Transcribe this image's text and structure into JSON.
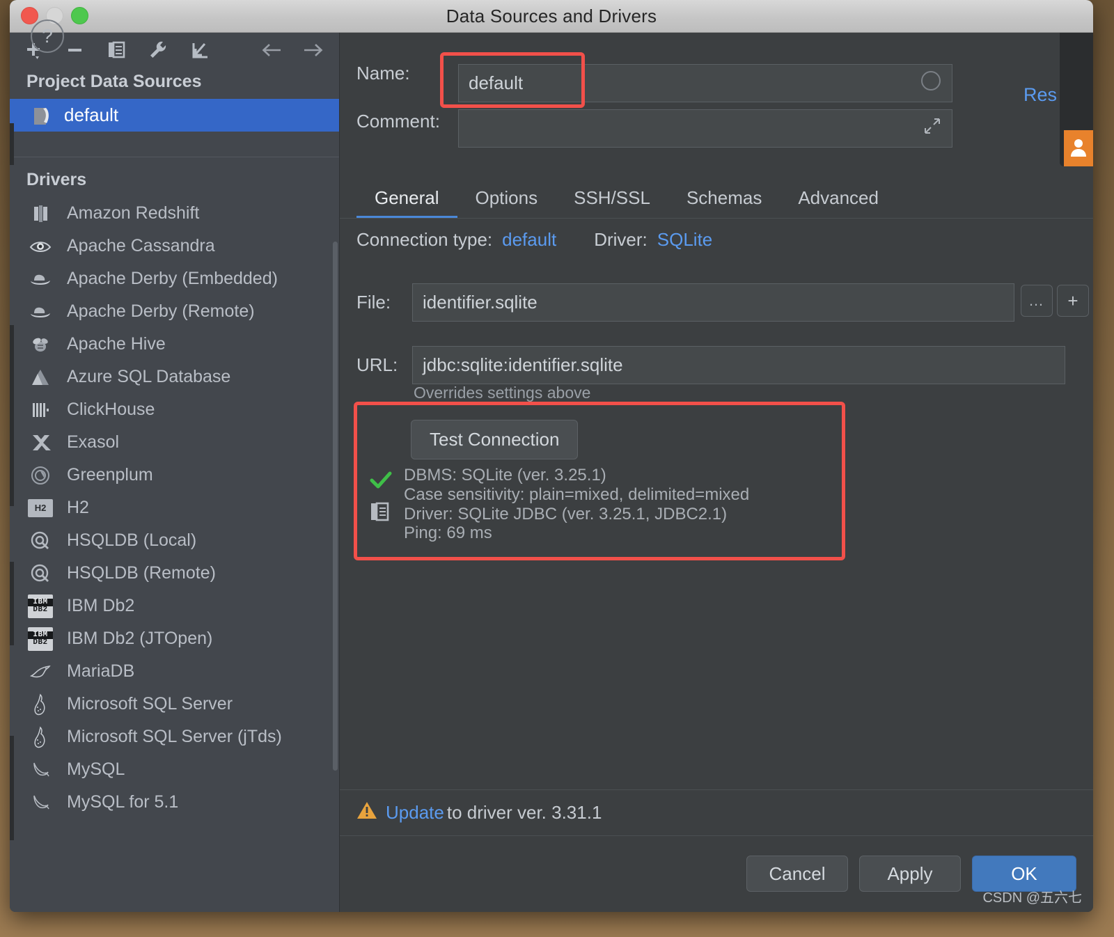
{
  "window": {
    "title": "Data Sources and Drivers",
    "traffic_lights": [
      "close",
      "minimize",
      "zoom"
    ]
  },
  "sidebar": {
    "toolbar": [
      {
        "name": "add-data-source-button",
        "icon": "plus-dropdown-icon"
      },
      {
        "name": "remove-data-source-button",
        "icon": "minus-icon"
      },
      {
        "name": "duplicate-data-source-button",
        "icon": "copy-icon"
      },
      {
        "name": "driver-properties-button",
        "icon": "wrench-icon"
      },
      {
        "name": "import-data-source-button",
        "icon": "import-arrow-icon"
      },
      {
        "name": "navigate-back-button",
        "icon": "arrow-left-icon"
      },
      {
        "name": "navigate-forward-button",
        "icon": "arrow-right-icon"
      }
    ],
    "project_sources_title": "Project Data Sources",
    "data_sources": [
      {
        "label": "default",
        "selected": true,
        "icon": "sqlite-icon"
      }
    ],
    "drivers_title": "Drivers",
    "drivers": [
      {
        "label": "Amazon Redshift",
        "icon": "redshift-icon"
      },
      {
        "label": "Apache Cassandra",
        "icon": "cassandra-eye-icon"
      },
      {
        "label": "Apache Derby (Embedded)",
        "icon": "derby-hat-icon"
      },
      {
        "label": "Apache Derby (Remote)",
        "icon": "derby-hat-icon"
      },
      {
        "label": "Apache Hive",
        "icon": "hive-bee-icon"
      },
      {
        "label": "Azure SQL Database",
        "icon": "azure-icon"
      },
      {
        "label": "ClickHouse",
        "icon": "clickhouse-icon"
      },
      {
        "label": "Exasol",
        "icon": "exasol-x-icon"
      },
      {
        "label": "Greenplum",
        "icon": "greenplum-icon"
      },
      {
        "label": "H2",
        "icon": "h2-icon"
      },
      {
        "label": "HSQLDB (Local)",
        "icon": "hsqldb-icon"
      },
      {
        "label": "HSQLDB (Remote)",
        "icon": "hsqldb-icon"
      },
      {
        "label": "IBM Db2",
        "icon": "ibm-db2-icon"
      },
      {
        "label": "IBM Db2 (JTOpen)",
        "icon": "ibm-db2-icon"
      },
      {
        "label": "MariaDB",
        "icon": "mariadb-seal-icon"
      },
      {
        "label": "Microsoft SQL Server",
        "icon": "mssql-icon"
      },
      {
        "label": "Microsoft SQL Server (jTds)",
        "icon": "mssql-icon"
      },
      {
        "label": "MySQL",
        "icon": "mysql-dolphin-icon"
      },
      {
        "label": "MySQL for 5.1",
        "icon": "mysql-dolphin-icon"
      }
    ]
  },
  "main": {
    "name_label": "Name:",
    "name_value": "default",
    "name_placeholder": "default",
    "comment_label": "Comment:",
    "comment_value": "",
    "comment_placeholder": "",
    "reset_link": "Res",
    "tabs": [
      {
        "label": "General",
        "active": true
      },
      {
        "label": "Options",
        "active": false
      },
      {
        "label": "SSH/SSL",
        "active": false
      },
      {
        "label": "Schemas",
        "active": false
      },
      {
        "label": "Advanced",
        "active": false
      }
    ],
    "connection_type_label": "Connection type:",
    "connection_type_value": "default",
    "driver_label": "Driver:",
    "driver_value": "SQLite",
    "file_label": "File:",
    "file_value": "identifier.sqlite",
    "file_browse_button": "…",
    "file_add_button": "+",
    "url_label": "URL:",
    "url_value": "jdbc:sqlite:identifier.sqlite",
    "url_hint": "Overrides settings above",
    "test_connection_button": "Test Connection",
    "test_result": {
      "status_icon": "check-icon",
      "copy_icon": "copy-icon",
      "lines": [
        "DBMS: SQLite (ver. 3.25.1)",
        "Case sensitivity: plain=mixed, delimited=mixed",
        "Driver: SQLite JDBC (ver. 3.25.1, JDBC2.1)",
        "Ping: 69 ms"
      ]
    }
  },
  "update_bar": {
    "warning_icon": "warning-triangle-icon",
    "link_text": "Update",
    "rest_text": " to driver ver. 3.31.1"
  },
  "footer": {
    "help_button": "?",
    "cancel_button": "Cancel",
    "apply_button": "Apply",
    "ok_button": "OK"
  },
  "watermark": "CSDN @五六七",
  "colors": {
    "accent_blue": "#4a88d8",
    "selection_blue": "#3567c7",
    "link_blue": "#5b9bf0",
    "highlight_red": "#f2504a",
    "success_green": "#4caf50",
    "warning_orange": "#e8a33d",
    "panel_bg": "#3c3f41",
    "sidebar_bg": "#43474d",
    "avatar_orange": "#e8822c"
  }
}
